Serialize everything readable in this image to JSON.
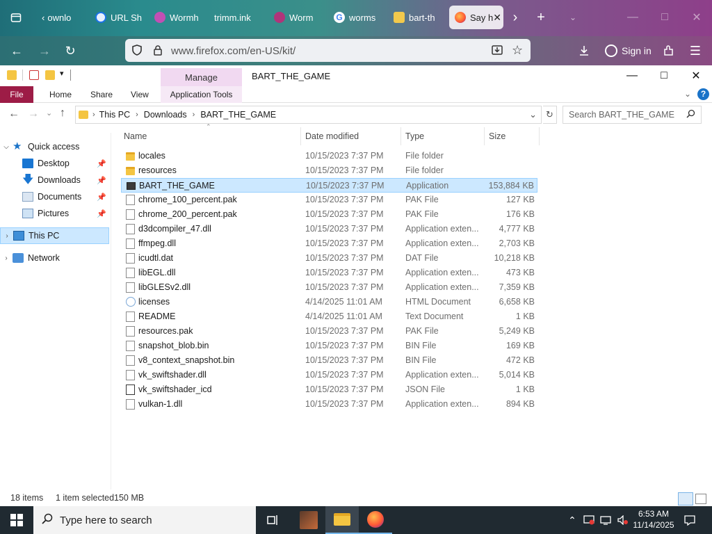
{
  "browser": {
    "tabs": [
      {
        "label": "ownlo",
        "icon": "download-arrow-icon"
      },
      {
        "label": "URL Sh",
        "icon": "link-icon"
      },
      {
        "label": "Wormh",
        "icon": "wormhole-icon"
      },
      {
        "label": "trimm.ink",
        "icon": ""
      },
      {
        "label": "Worm",
        "icon": "wormhole-icon"
      },
      {
        "label": "worms",
        "icon": "google-icon"
      },
      {
        "label": "bart-th",
        "icon": "bart-icon"
      },
      {
        "label": "Say h",
        "icon": "firefox-icon"
      }
    ],
    "url": "www.firefox.com/en-US/kit/",
    "sign_in": "Sign in"
  },
  "explorer": {
    "title": "BART_THE_GAME",
    "manage_tab": "Manage",
    "app_tools": "Application Tools",
    "ribbon_tabs": [
      "File",
      "Home",
      "Share",
      "View"
    ],
    "breadcrumb": [
      "This PC",
      "Downloads",
      "BART_THE_GAME"
    ],
    "search_placeholder": "Search BART_THE_GAME",
    "nav": {
      "quick_access": "Quick access",
      "items": [
        "Desktop",
        "Downloads",
        "Documents",
        "Pictures"
      ],
      "this_pc": "This PC",
      "network": "Network"
    },
    "columns": [
      "Name",
      "Date modified",
      "Type",
      "Size"
    ],
    "files": [
      {
        "name": "locales",
        "date": "10/15/2023 7:37 PM",
        "type": "File folder",
        "size": "",
        "icon": "folder"
      },
      {
        "name": "resources",
        "date": "10/15/2023 7:37 PM",
        "type": "File folder",
        "size": "",
        "icon": "folder"
      },
      {
        "name": "BART_THE_GAME",
        "date": "10/15/2023 7:37 PM",
        "type": "Application",
        "size": "153,884 KB",
        "icon": "app"
      },
      {
        "name": "chrome_100_percent.pak",
        "date": "10/15/2023 7:37 PM",
        "type": "PAK File",
        "size": "127 KB",
        "icon": "file"
      },
      {
        "name": "chrome_200_percent.pak",
        "date": "10/15/2023 7:37 PM",
        "type": "PAK File",
        "size": "176 KB",
        "icon": "file"
      },
      {
        "name": "d3dcompiler_47.dll",
        "date": "10/15/2023 7:37 PM",
        "type": "Application exten...",
        "size": "4,777 KB",
        "icon": "dll"
      },
      {
        "name": "ffmpeg.dll",
        "date": "10/15/2023 7:37 PM",
        "type": "Application exten...",
        "size": "2,703 KB",
        "icon": "dll"
      },
      {
        "name": "icudtl.dat",
        "date": "10/15/2023 7:37 PM",
        "type": "DAT File",
        "size": "10,218 KB",
        "icon": "file"
      },
      {
        "name": "libEGL.dll",
        "date": "10/15/2023 7:37 PM",
        "type": "Application exten...",
        "size": "473 KB",
        "icon": "dll"
      },
      {
        "name": "libGLESv2.dll",
        "date": "10/15/2023 7:37 PM",
        "type": "Application exten...",
        "size": "7,359 KB",
        "icon": "dll"
      },
      {
        "name": "licenses",
        "date": "4/14/2025 11:01 AM",
        "type": "HTML Document",
        "size": "6,658 KB",
        "icon": "html"
      },
      {
        "name": "README",
        "date": "4/14/2025 11:01 AM",
        "type": "Text Document",
        "size": "1 KB",
        "icon": "text"
      },
      {
        "name": "resources.pak",
        "date": "10/15/2023 7:37 PM",
        "type": "PAK File",
        "size": "5,249 KB",
        "icon": "file"
      },
      {
        "name": "snapshot_blob.bin",
        "date": "10/15/2023 7:37 PM",
        "type": "BIN File",
        "size": "169 KB",
        "icon": "file"
      },
      {
        "name": "v8_context_snapshot.bin",
        "date": "10/15/2023 7:37 PM",
        "type": "BIN File",
        "size": "472 KB",
        "icon": "file"
      },
      {
        "name": "vk_swiftshader.dll",
        "date": "10/15/2023 7:37 PM",
        "type": "Application exten...",
        "size": "5,014 KB",
        "icon": "dll"
      },
      {
        "name": "vk_swiftshader_icd",
        "date": "10/15/2023 7:37 PM",
        "type": "JSON File",
        "size": "1 KB",
        "icon": "json"
      },
      {
        "name": "vulkan-1.dll",
        "date": "10/15/2023 7:37 PM",
        "type": "Application exten...",
        "size": "894 KB",
        "icon": "dll"
      }
    ],
    "selected_index": 2,
    "status": {
      "count": "18 items",
      "selected": "1 item selected",
      "size": "150 MB"
    }
  },
  "taskbar": {
    "search_placeholder": "Type here to search",
    "time": "6:53 AM",
    "date": "11/14/2025"
  }
}
